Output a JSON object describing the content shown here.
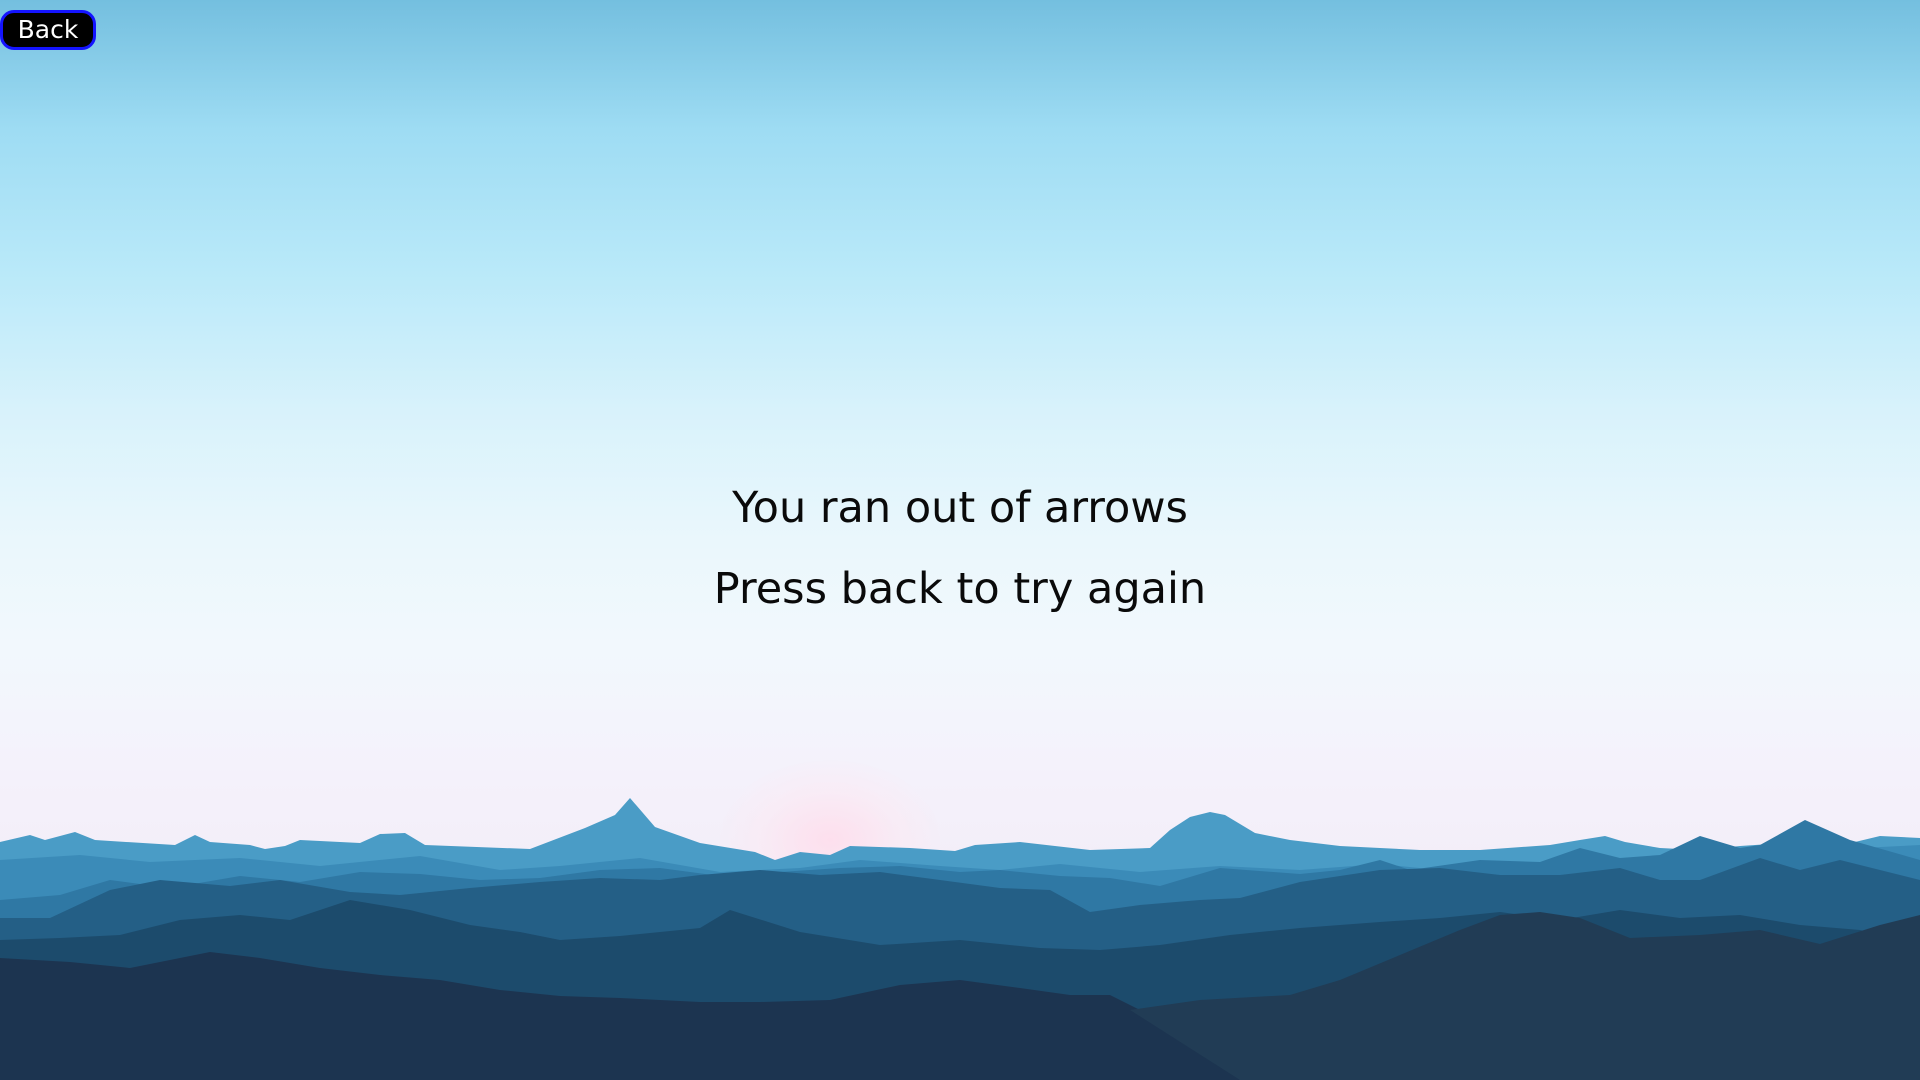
{
  "back_button": {
    "label": "Back"
  },
  "message": {
    "line1": "You ran out of arrows",
    "line2": "Press back to try again"
  },
  "colors": {
    "button_fill": "#000000",
    "button_border": "#1414ff",
    "button_text": "#ffffff",
    "text": "#0a0a0a"
  },
  "background": {
    "scene": "sky-with-mountain-range",
    "icon": "mountains-landscape"
  }
}
